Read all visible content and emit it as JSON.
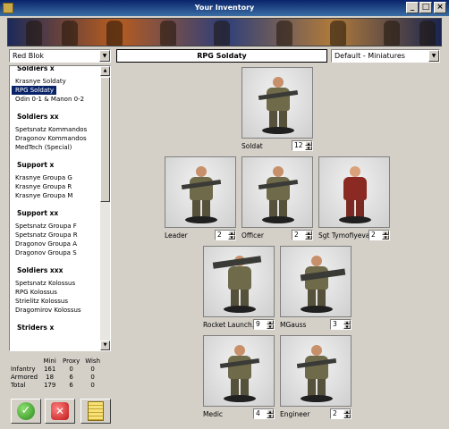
{
  "window": {
    "title": "Your Inventory",
    "minimize": "_",
    "maximize": "□",
    "close": "×"
  },
  "left_combo": {
    "value": "Red Blok"
  },
  "center_title": "RPG Soldaty",
  "right_combo": {
    "value": "Default - Miniatures"
  },
  "list": {
    "groups": [
      {
        "header": "Soldiers x",
        "items": [
          "Krasnye Soldaty",
          "RPG Soldaty",
          "Odin 0-1 & Manon 0-2"
        ],
        "selected": 1
      },
      {
        "header": "Soldiers xx",
        "items": [
          "Spetsnatz Kommandos",
          "Dragonov Kommandos",
          "MedTech (Special)"
        ]
      },
      {
        "header": "Support x",
        "items": [
          "Krasnye Groupa G",
          "Krasnye Groupa R",
          "Krasnye Groupa M"
        ]
      },
      {
        "header": "Support xx",
        "items": [
          "Spetsnatz Groupa F",
          "Spetsnatz Groupa R",
          "Dragonov Groupa A",
          "Dragonov Groupa S"
        ]
      },
      {
        "header": "Soldiers xxx",
        "items": [
          "Spetsnatz Kolossus",
          "RPG Kolossus",
          "Strielitz Kolossus",
          "Dragomirov Kolossus"
        ]
      },
      {
        "header": "Striders x",
        "items": []
      }
    ]
  },
  "stats": {
    "headers": [
      "",
      "Mini",
      "Proxy",
      "Wish"
    ],
    "rows": [
      {
        "label": "Infantry",
        "mini": "161",
        "proxy": "0",
        "wish": "0"
      },
      {
        "label": "Armored",
        "mini": "18",
        "proxy": "6",
        "wish": "0"
      },
      {
        "label": "Total",
        "mini": "179",
        "proxy": "6",
        "wish": "0"
      }
    ]
  },
  "gallery": {
    "cards": [
      {
        "label": "Soldat",
        "qty": "12"
      },
      {
        "label": "Leader",
        "qty": "2"
      },
      {
        "label": "Officer",
        "qty": "2"
      },
      {
        "label": "Sgt Tymofiyeva",
        "qty": "2"
      },
      {
        "label": "Rocket Launch.",
        "qty": "9"
      },
      {
        "label": "MGauss",
        "qty": "3"
      },
      {
        "label": "Medic",
        "qty": "4"
      },
      {
        "label": "Engineer",
        "qty": "2"
      }
    ]
  },
  "icons": {
    "ok": "ok-check-icon",
    "cancel": "cancel-x-icon",
    "notes": "notes-icon"
  },
  "colors": {
    "title_bar": "#0a246a",
    "selection": "#0a246a",
    "window_bg": "#d4d0c8"
  }
}
